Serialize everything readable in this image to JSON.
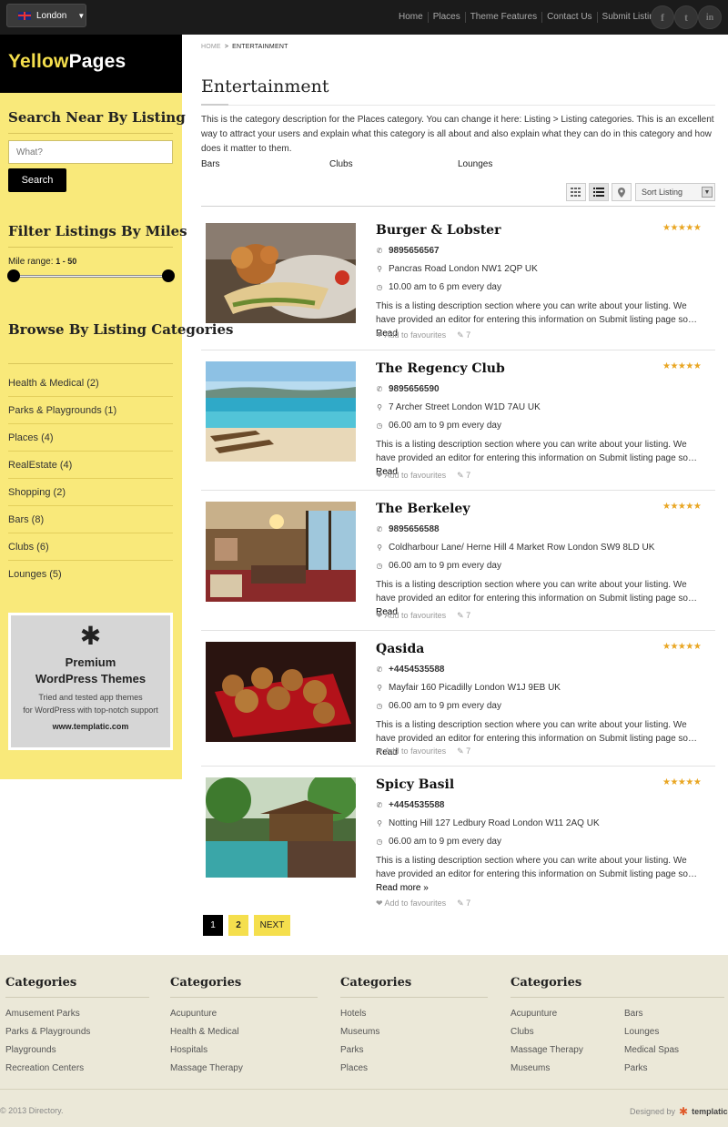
{
  "topbar": {
    "city": "London",
    "nav": [
      "Home",
      "Places",
      "Theme Features",
      "Contact Us",
      "Submit Listing"
    ],
    "social": [
      "f",
      "t",
      "in"
    ]
  },
  "logo": {
    "part1": "Yellow",
    "part2": "Pages"
  },
  "sidebar": {
    "search_heading": "Search Near By Listing",
    "search_placeholder": "What?",
    "search_button": "Search",
    "filter_heading": "Filter Listings By Miles",
    "mile_label": "Mile range:",
    "mile_value": "1 - 50",
    "mile_min": 1,
    "mile_max": 50,
    "browse_heading": "Browse By Listing Categories",
    "categories": [
      "Health & Medical (2)",
      "Parks & Playgrounds (1)",
      "Places (4)",
      "RealEstate (4)",
      "Shopping (2)",
      "Bars (8)",
      "Clubs (6)",
      "Lounges (5)"
    ],
    "ad": {
      "title1": "Premium",
      "title2": "WordPress Themes",
      "line1": "Tried and tested app themes",
      "line2": "for WordPress with top-notch support",
      "url": "www.templatic.com"
    }
  },
  "breadcrumb": {
    "home": "HOME",
    "current": "ENTERTAINMENT"
  },
  "page": {
    "title": "Entertainment",
    "description": "This is the category description for the Places category. You can change it here: Listing > Listing categories. This is an excellent way to attract your users and explain what this category is all about and also explain what they can do in this category and how does it matter to them.",
    "subcategories": [
      "Bars",
      "Clubs",
      "Lounges"
    ],
    "sort_label": "Sort Listing"
  },
  "listings": [
    {
      "title": "Burger & Lobster",
      "phone": "9895656567",
      "address": "Pancras Road London NW1 2QP UK",
      "hours": "10.00 am to 6 pm every day",
      "description": "This is a listing description section where you can write about your listing. We have provided an editor for entering this information on Submit listing page so…",
      "read": "Read",
      "read_more": "",
      "favourite": "Add to favourites",
      "comments": "7",
      "rating": 5
    },
    {
      "title": "The Regency Club",
      "phone": "9895656590",
      "address": "7 Archer Street London W1D 7AU UK",
      "hours": "06.00 am to 9 pm every day",
      "description": "This is a listing description section where you can write about your listing. We have provided an editor for entering this information on Submit listing page so…",
      "read": "Read",
      "read_more": "",
      "favourite": "Add to favourites",
      "comments": "7",
      "rating": 5
    },
    {
      "title": "The Berkeley",
      "phone": "9895656588",
      "address": "Coldharbour Lane/ Herne Hill 4 Market Row London SW9 8LD UK",
      "hours": "06.00 am to 9 pm every day",
      "description": "This is a listing description section where you can write about your listing. We have provided an editor for entering this information on Submit listing page so…",
      "read": "Read",
      "read_more": "",
      "favourite": "Add to favourites",
      "comments": "7",
      "rating": 5
    },
    {
      "title": "Qasida",
      "phone": "+4454535588",
      "address": "Mayfair 160 Picadilly London W1J 9EB UK",
      "hours": "06.00 am to 9 pm every day",
      "description": "This is a listing description section where you can write about your listing. We have provided an editor for entering this information on Submit listing page so…",
      "read": "Read",
      "read_more": "",
      "favourite": "Add to favourites",
      "comments": "7",
      "rating": 5
    },
    {
      "title": "Spicy Basil",
      "phone": "+4454535588",
      "address": "Notting Hill 127 Ledbury Road London W11 2AQ UK",
      "hours": "06.00 am to 9 pm every day",
      "description": "This is a listing description section where you can write about your listing. We have provided an editor for entering this information on Submit listing page so…",
      "read": "Read",
      "read_more": "more »",
      "favourite": "Add to favourites",
      "comments": "7",
      "rating": 5
    }
  ],
  "pagination": {
    "pages": [
      "1",
      "2"
    ],
    "current": "1",
    "next": "NEXT"
  },
  "footer": {
    "columns": [
      {
        "heading": "Categories",
        "links": [
          "Amusement Parks",
          "Parks & Playgrounds",
          "Playgrounds",
          "Recreation Centers"
        ]
      },
      {
        "heading": "Categories",
        "links": [
          "Acupunture",
          "Health & Medical",
          "Hospitals",
          "Massage Therapy"
        ]
      },
      {
        "heading": "Categories",
        "links": [
          "Hotels",
          "Museums",
          "Parks",
          "Places"
        ]
      },
      {
        "heading": "Categories",
        "links": [
          "Acupunture",
          "Clubs",
          "Massage Therapy",
          "Museums",
          "Bars",
          "Lounges",
          "Medical Spas",
          "Parks"
        ]
      }
    ],
    "copyright": "© 2013 Directory.",
    "designed_by": "Designed by",
    "brand": "templatic"
  },
  "colors": {
    "accent_yellow": "#f9e97a",
    "logo_yellow": "#f5df4d",
    "topbar": "#1b1b1b",
    "star": "#e9a623",
    "footer_bg": "#ebe8d8"
  }
}
